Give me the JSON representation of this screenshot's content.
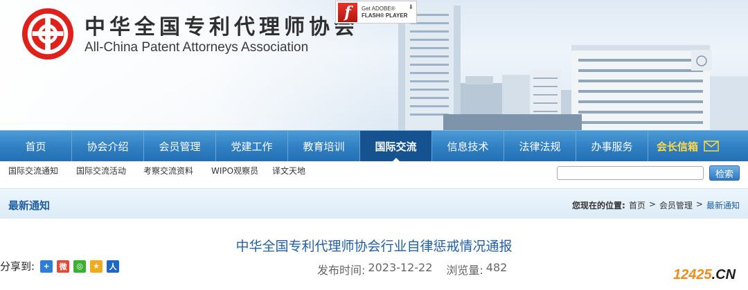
{
  "header": {
    "title_cn": "中华全国专利代理师协会",
    "title_en": "All-China Patent Attorneys Association",
    "flash": {
      "line1": "Get ADOBE®",
      "line2": "FLASH® PLAYER"
    }
  },
  "nav": {
    "items": [
      {
        "label": "首页"
      },
      {
        "label": "协会介绍"
      },
      {
        "label": "会员管理"
      },
      {
        "label": "党建工作"
      },
      {
        "label": "教育培训"
      },
      {
        "label": "国际交流",
        "active": true
      },
      {
        "label": "信息技术"
      },
      {
        "label": "法律法规"
      },
      {
        "label": "办事服务"
      }
    ],
    "special_label": "会长信箱"
  },
  "subnav": {
    "items": [
      "国际交流通知",
      "国际交流活动",
      "考察交流资料",
      "WIPO观察员",
      "译文天地"
    ]
  },
  "search": {
    "value": "",
    "button_label": "检索"
  },
  "section": {
    "title": "最新通知",
    "breadcrumb_prefix": "您现在的位置:",
    "breadcrumb": [
      "首页",
      "会员管理",
      "最新通知"
    ],
    "separator": ">"
  },
  "article": {
    "title": "中华全国专利代理师协会行业自律惩戒情况通报",
    "share_label": "分享到:",
    "date_label": "发布时间:",
    "date": "2023-12-22",
    "views_label": "浏览量:",
    "views": "482"
  },
  "watermark": {
    "number": "12425",
    "domain": ".CN"
  },
  "colors": {
    "nav_blue": "#2f7fc2",
    "active_blue": "#15528f",
    "accent_text": "#1f5fa8",
    "logo_red": "#e0201a"
  }
}
